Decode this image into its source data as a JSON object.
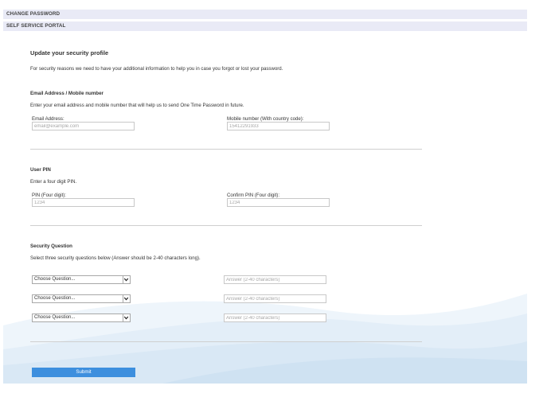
{
  "nav": {
    "change_password": "CHANGE PASSWORD",
    "self_service_portal": "SELF SERVICE PORTAL"
  },
  "page": {
    "title": "Update your security profile",
    "intro": "For security reasons we need to have your additional information to help you in case you forgot or lost your password."
  },
  "contact": {
    "heading": "Email Address / Mobile number",
    "description": "Enter your email address and mobile number that will help us to send One Time Password in future.",
    "email_label": "Email Address:",
    "email_placeholder": "email@example.com",
    "mobile_label": "Mobile number (With country code):",
    "mobile_placeholder": "15412291933"
  },
  "pin": {
    "heading": "User PIN",
    "description": "Enter a four digit PIN.",
    "pin_label": "PIN (Four digit):",
    "pin_placeholder": "1234",
    "confirm_label": "Confirm PIN (Four digit):",
    "confirm_placeholder": "1234"
  },
  "security": {
    "heading": "Security Question",
    "description": "Select three security questions below (Answer should be 2-40 characters long).",
    "questions": [
      {
        "select_value": "Choose Question...",
        "answer_placeholder": "Answer (2-40 characters)"
      },
      {
        "select_value": "Choose Question...",
        "answer_placeholder": "Answer (2-40 characters)"
      },
      {
        "select_value": "Choose Question...",
        "answer_placeholder": "Answer (2-40 characters)"
      }
    ]
  },
  "submit_label": "Submit",
  "colors": {
    "nav_bar": "#e9eaf6",
    "submit": "#3d8fde",
    "wave": "#dbe9f6"
  },
  "icons": {
    "select_arrow": "chevron-down-icon",
    "background": "wave-background"
  }
}
